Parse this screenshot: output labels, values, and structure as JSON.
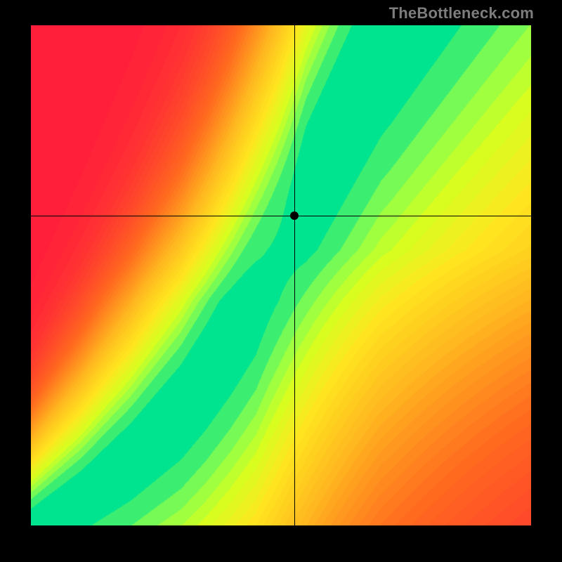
{
  "watermark": "TheBottleneck.com",
  "chart_data": {
    "type": "heatmap",
    "title": "",
    "xlabel": "",
    "ylabel": "",
    "xlim": [
      0,
      1
    ],
    "ylim": [
      0,
      1
    ],
    "crosshair": {
      "x": 0.527,
      "y": 0.62
    },
    "marker": {
      "x": 0.527,
      "y": 0.62
    },
    "ridge_points": [
      {
        "x": 0.0,
        "y": 0.0
      },
      {
        "x": 0.05,
        "y": 0.03
      },
      {
        "x": 0.1,
        "y": 0.06
      },
      {
        "x": 0.15,
        "y": 0.1
      },
      {
        "x": 0.2,
        "y": 0.14
      },
      {
        "x": 0.25,
        "y": 0.19
      },
      {
        "x": 0.3,
        "y": 0.24
      },
      {
        "x": 0.35,
        "y": 0.31
      },
      {
        "x": 0.4,
        "y": 0.39
      },
      {
        "x": 0.45,
        "y": 0.48
      },
      {
        "x": 0.5,
        "y": 0.57
      },
      {
        "x": 0.55,
        "y": 0.67
      },
      {
        "x": 0.6,
        "y": 0.77
      },
      {
        "x": 0.65,
        "y": 0.87
      },
      {
        "x": 0.7,
        "y": 0.97
      },
      {
        "x": 0.72,
        "y": 1.0
      }
    ],
    "ridge_width": [
      {
        "x": 0.0,
        "w": 0.008
      },
      {
        "x": 0.1,
        "w": 0.015
      },
      {
        "x": 0.2,
        "w": 0.022
      },
      {
        "x": 0.3,
        "w": 0.03
      },
      {
        "x": 0.4,
        "w": 0.04
      },
      {
        "x": 0.5,
        "w": 0.05
      },
      {
        "x": 0.6,
        "w": 0.06
      },
      {
        "x": 0.72,
        "w": 0.075
      }
    ],
    "color_stops": [
      {
        "t": 0.0,
        "color": "#ff1f3a"
      },
      {
        "t": 0.35,
        "color": "#ff6a1f"
      },
      {
        "t": 0.6,
        "color": "#ffb81f"
      },
      {
        "t": 0.78,
        "color": "#ffe61f"
      },
      {
        "t": 0.88,
        "color": "#d6ff1f"
      },
      {
        "t": 0.94,
        "color": "#8fff4a"
      },
      {
        "t": 1.0,
        "color": "#00e38f"
      }
    ]
  }
}
